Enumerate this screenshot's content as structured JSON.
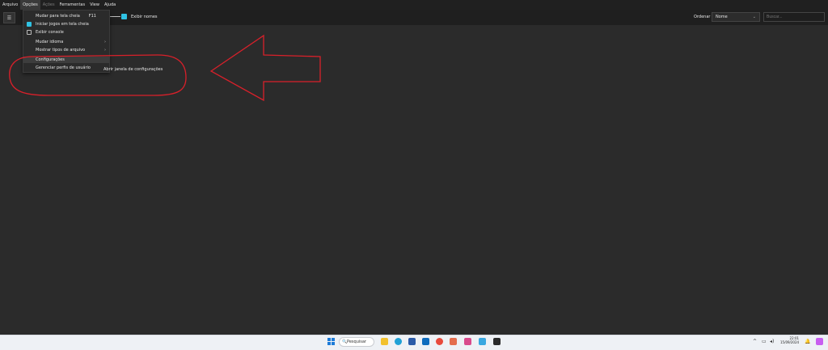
{
  "menubar": {
    "items": [
      {
        "label": "Arquivo"
      },
      {
        "label": "Opções",
        "active": true
      },
      {
        "label": "Ações",
        "disabled": true
      },
      {
        "label": "Ferramentas"
      },
      {
        "label": "View"
      },
      {
        "label": "Ajuda"
      }
    ]
  },
  "toolbar": {
    "show_names_label": "Exibir nomes",
    "order_label": "Ordenar",
    "order_value": "Nome",
    "search_placeholder": "Buscar..."
  },
  "dropdown": {
    "items": [
      {
        "label": "Mudar para tela cheia",
        "shortcut": "F11"
      },
      {
        "label": "Iniciar jogos em tela cheia",
        "checked": true
      },
      {
        "label": "Exibir console",
        "checked": false
      },
      {
        "label": "Mudar idioma",
        "submenu": true
      },
      {
        "label": "Mostrar tipos de arquivo",
        "submenu": true
      },
      {
        "label": "Configurações",
        "highlighted": true
      },
      {
        "label": "Gerenciar perfis de usuário"
      }
    ]
  },
  "tooltip": "Abrir janela de configurações",
  "taskbar": {
    "search_label": "Pesquisar",
    "time": "22:01",
    "date": "15/09/2024"
  },
  "colors": {
    "accent": "#2fc2e3",
    "annotation": "#d9202a",
    "background": "#2b2b2b"
  },
  "icons": [
    "hamburger-icon",
    "windows-icon",
    "search-icon",
    "file-explorer-icon",
    "edge-icon",
    "store-icon",
    "outlook-icon",
    "chrome-icon",
    "photos-icon",
    "paint-icon",
    "app-icon",
    "terminal-icon",
    "chevron-up-icon",
    "network-icon",
    "volume-icon",
    "bell-icon"
  ]
}
